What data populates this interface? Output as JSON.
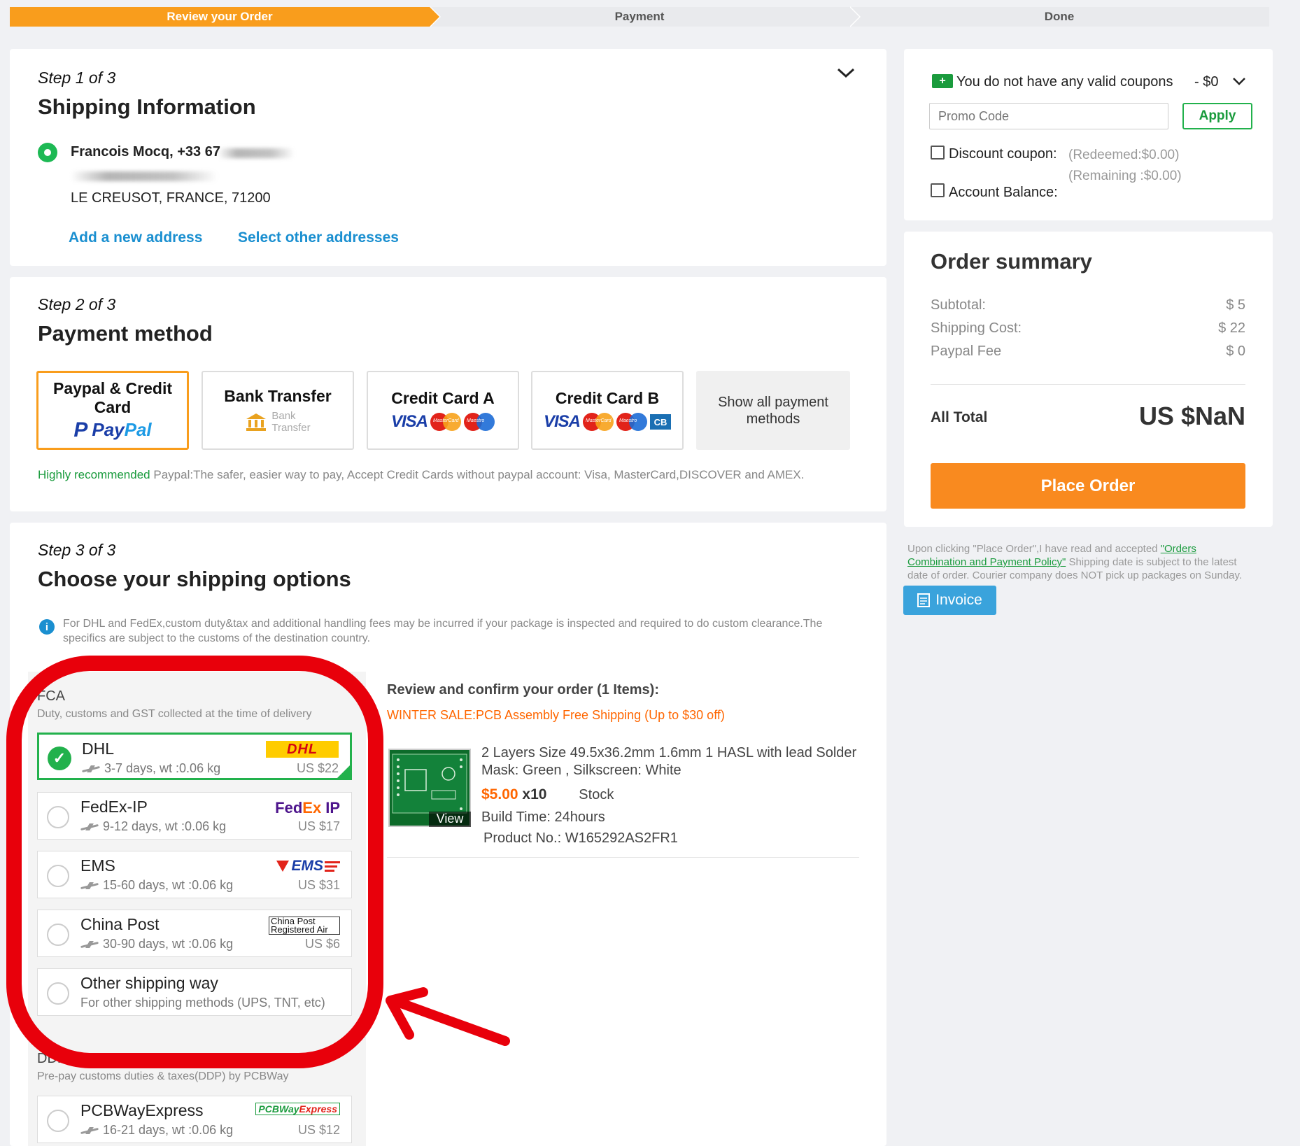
{
  "progress": {
    "steps": [
      "Review your Order",
      "Payment",
      "Done"
    ]
  },
  "shipping_info": {
    "step_label": "Step 1 of 3",
    "title": "Shipping Information",
    "name_line": "Francois Mocq, +33 67",
    "city_line": "LE CREUSOT, FRANCE, 71200",
    "add_address": "Add a new address",
    "select_other": "Select other addresses"
  },
  "payment": {
    "step_label": "Step 2 of 3",
    "title": "Payment method",
    "methods": [
      {
        "label": "Paypal & Credit Card",
        "logo": "PayPal",
        "logo_a": "Pay",
        "logo_b": "Pal"
      },
      {
        "label": "Bank Transfer",
        "logo": "Bank Transfer",
        "logo_a": "Bank",
        "logo_b": "Transfer"
      },
      {
        "label": "Credit Card A",
        "logo": "VISA"
      },
      {
        "label": "Credit Card B",
        "logo": "VISA"
      }
    ],
    "mc_small": "MasterCard",
    "maestro_small": "Maestro",
    "cb": "CB",
    "show_all": "Show all payment methods",
    "recommend_highlight": "Highly recommended",
    "recommend_text": "Paypal:The safer, easier way to pay, Accept Credit Cards without paypal account: Visa, MasterCard,DISCOVER and AMEX."
  },
  "shipping_options": {
    "step_label": "Step 3 of 3",
    "title": "Choose your shipping options",
    "info_note": "For DHL and FedEx,custom duty&tax and additional handling fees may be incurred if your package is inspected and required to do custom clearance.The specifics are subject to the customs of the destination country.",
    "group1_title": "FCA",
    "group1_sub": "Duty, customs and GST collected at the time of delivery",
    "options": [
      {
        "name": "DHL",
        "sub": "3-7 days, wt :0.06 kg",
        "price": "US $22",
        "logo": "DHL",
        "selected": true
      },
      {
        "name": "FedEx-IP",
        "sub": "9-12 days, wt :0.06 kg",
        "price": "US $17",
        "logo": "FedEx IP"
      },
      {
        "name": "EMS",
        "sub": "15-60 days, wt :0.06 kg",
        "price": "US $31",
        "logo": "EMS"
      },
      {
        "name": "China Post",
        "sub": "30-90 days, wt :0.06 kg",
        "price": "US $6",
        "logo": "China Post Registered Air"
      },
      {
        "name": "Other shipping way",
        "sub": "For other shipping methods (UPS, TNT, etc)"
      }
    ],
    "logo_fedex_a": "Fed",
    "logo_fedex_b": "Ex",
    "logo_fedex_c": "IP",
    "logo_china_a": "China Post",
    "logo_china_b": "Registered Air",
    "logo_pcbway_a": "PCBWay",
    "logo_pcbway_b": "Express",
    "group2_title": "DDP",
    "group2_sub": "Pre-pay customs duties & taxes(DDP) by PCBWay",
    "ddp_option": {
      "name": "PCBWayExpress",
      "sub": "16-21 days, wt :0.06 kg",
      "price": "US $12",
      "logo": "PCBWayExpress"
    }
  },
  "review": {
    "title": "Review and confirm your order (1 Items):",
    "sale": "WINTER SALE:PCB Assembly Free Shipping (Up to $30 off)",
    "item": {
      "desc": "2 Layers Size 49.5x36.2mm 1.6mm 1 HASL with lead Solder Mask: Green , Silkscreen: White",
      "price": "$5.00",
      "qty": "x10",
      "stock": "Stock",
      "build": "Build Time: 24hours",
      "product_no": "Product No.: W165292AS2FR1",
      "view": "View"
    }
  },
  "coupons": {
    "msg": "You do not have any valid coupons",
    "amount": "- $0",
    "promo_placeholder": "Promo Code",
    "apply": "Apply",
    "discount_label": "Discount coupon:",
    "account_label": "Account Balance:",
    "redeemed": "(Redeemed:$0.00)",
    "remaining": "(Remaining :$0.00)"
  },
  "summary": {
    "title": "Order summary",
    "rows": [
      {
        "label": "Subtotal:",
        "value": "$ 5"
      },
      {
        "label": "Shipping Cost:",
        "value": "$ 22"
      },
      {
        "label": "Paypal Fee",
        "value": "$ 0"
      }
    ],
    "total_label": "All Total",
    "total_value": "US $NaN",
    "place_order": "Place Order",
    "policy_pre": "Upon clicking \"Place Order\",I have read and accepted ",
    "policy_link": "\"Orders Combination and Payment Policy\"",
    "policy_post": " Shipping date is subject to the latest date of order. Courier company does NOT pick up packages on Sunday.",
    "invoice": "Invoice"
  },
  "colors": {
    "accent_orange": "#f99d1c",
    "green": "#22b14c",
    "link_blue": "#1a8fd0",
    "annotation_red": "#e8000b"
  }
}
